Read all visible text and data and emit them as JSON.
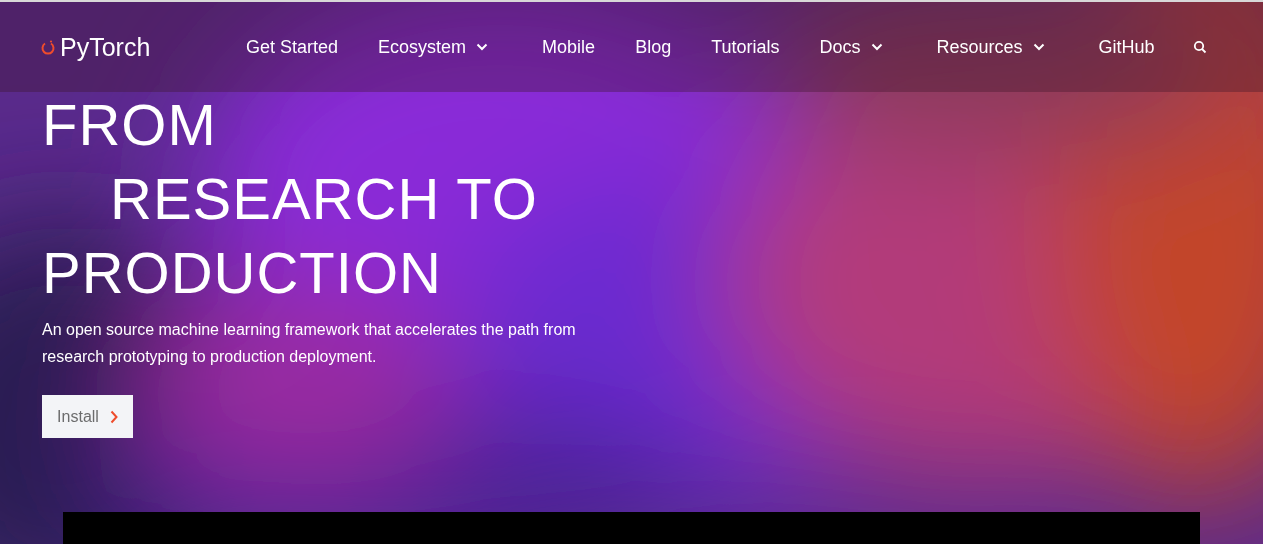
{
  "header": {
    "logo": "PyTorch",
    "nav": [
      {
        "label": "Get Started",
        "dropdown": false
      },
      {
        "label": "Ecosystem",
        "dropdown": true
      },
      {
        "label": "Mobile",
        "dropdown": false
      },
      {
        "label": "Blog",
        "dropdown": false
      },
      {
        "label": "Tutorials",
        "dropdown": false
      },
      {
        "label": "Docs",
        "dropdown": true
      },
      {
        "label": "Resources",
        "dropdown": true
      },
      {
        "label": "GitHub",
        "dropdown": false
      }
    ]
  },
  "hero": {
    "title_lines": [
      {
        "text": "FROM",
        "indented": false
      },
      {
        "text": "RESEARCH TO",
        "indented": true
      },
      {
        "text": "PRODUCTION",
        "indented": false
      }
    ],
    "description": "An open source machine learning framework that accelerates the path from research prototyping to production deployment.",
    "button": "Install"
  }
}
